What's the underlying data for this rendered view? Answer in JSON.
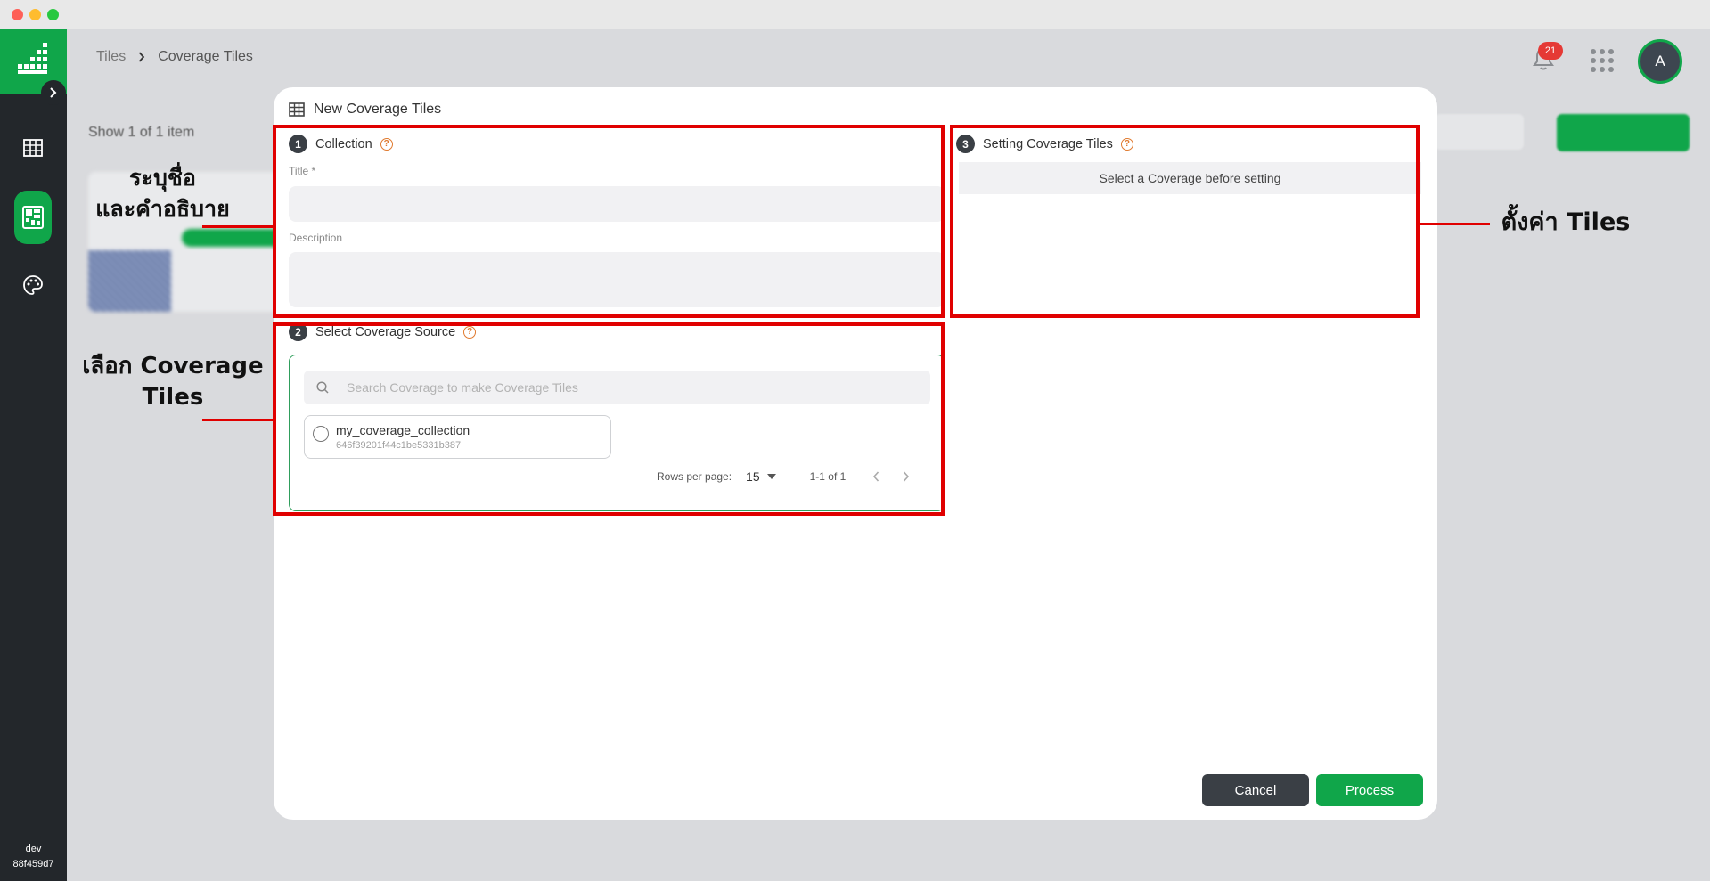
{
  "breadcrumb": {
    "root": "Tiles",
    "current": "Coverage Tiles"
  },
  "header": {
    "notification_count": "21",
    "avatar_initial": "A"
  },
  "sidebar": {
    "env_name": "dev",
    "env_hash": "88f459d7"
  },
  "background": {
    "show_count": "Show 1 of 1 item"
  },
  "modal": {
    "title": "New Coverage Tiles",
    "step1": {
      "number": "1",
      "label": "Collection",
      "title_label": "Title *",
      "description_label": "Description"
    },
    "step2": {
      "number": "2",
      "label": "Select Coverage Source",
      "search_placeholder": "Search Coverage to make Coverage Tiles",
      "items": [
        {
          "name": "my_coverage_collection",
          "id": "646f39201f44c1be5331b387"
        }
      ],
      "rows_per_page_label": "Rows per page:",
      "rows_per_page": "15",
      "range": "1-1 of 1"
    },
    "step3": {
      "number": "3",
      "label": "Setting Coverage Tiles",
      "notice": "Select a Coverage before setting"
    },
    "cancel_label": "Cancel",
    "process_label": "Process"
  },
  "annotations": {
    "name_desc": "ระบุชื่อ\nและคำอธิบาย",
    "select_tiles": "เลือก Coverage\nTiles",
    "setting_tiles": "ตั้งค่า Tiles"
  },
  "colors": {
    "brand_green": "#10a64a",
    "annotation_red": "#e00000",
    "sidebar_dark": "#23272b"
  }
}
